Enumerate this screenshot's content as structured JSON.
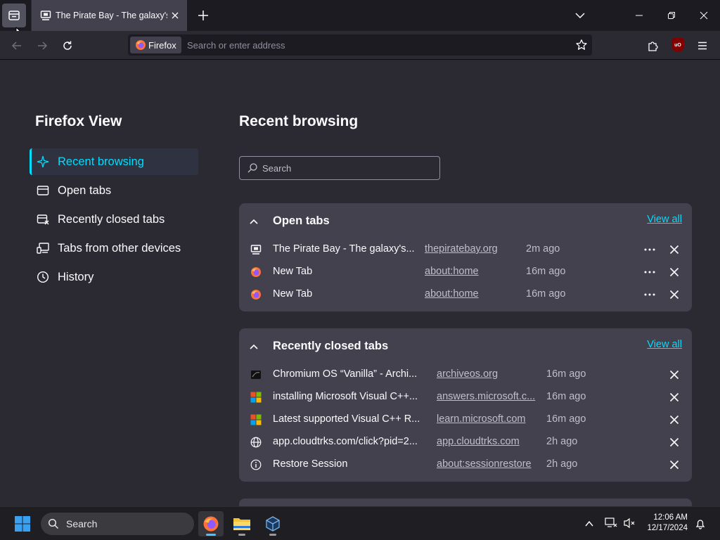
{
  "tab": {
    "title": "The Pirate Bay - The galaxy's m"
  },
  "urlbar": {
    "identity_label": "Firefox",
    "placeholder": "Search or enter address"
  },
  "extension": {
    "ublock_label": "uO"
  },
  "sidebar": {
    "title": "Firefox View",
    "items": [
      {
        "label": "Recent browsing",
        "icon": "sparkle-icon",
        "active": true
      },
      {
        "label": "Open tabs",
        "icon": "folder-tab-icon"
      },
      {
        "label": "Recently closed tabs",
        "icon": "closed-tab-icon"
      },
      {
        "label": "Tabs from other devices",
        "icon": "devices-icon"
      },
      {
        "label": "History",
        "icon": "clock-icon"
      }
    ]
  },
  "main": {
    "title": "Recent browsing",
    "search_placeholder": "Search",
    "open_tabs": {
      "heading": "Open tabs",
      "view_all": "View all",
      "rows": [
        {
          "title": "The Pirate Bay - The galaxy's...",
          "url": "thepiratebay.org",
          "time": "2m ago",
          "icon": "pirate-ship-icon"
        },
        {
          "title": "New Tab",
          "url": "about:home",
          "time": "16m ago",
          "icon": "firefox-icon"
        },
        {
          "title": "New Tab",
          "url": "about:home",
          "time": "16m ago",
          "icon": "firefox-icon"
        }
      ]
    },
    "closed_tabs": {
      "heading": "Recently closed tabs",
      "view_all": "View all",
      "rows": [
        {
          "title": "Chromium OS “Vanilla” - Archi...",
          "url": "archiveos.org",
          "time": "16m ago",
          "icon": "archiveos-icon"
        },
        {
          "title": "installing Microsoft Visual C++...",
          "url": "answers.microsoft.c...",
          "time": "16m ago",
          "icon": "microsoft-icon"
        },
        {
          "title": "Latest supported Visual C++ R...",
          "url": "learn.microsoft.com",
          "time": "16m ago",
          "icon": "microsoft-icon"
        },
        {
          "title": "app.cloudtrks.com/click?pid=2...",
          "url": "app.cloudtrks.com",
          "time": "2h ago",
          "icon": "globe-icon"
        },
        {
          "title": "Restore Session",
          "url": "about:sessionrestore",
          "time": "2h ago",
          "icon": "info-icon"
        }
      ]
    }
  },
  "taskbar": {
    "search_label": "Search",
    "clock_time": "12:06 AM",
    "clock_date": "12/17/2024"
  },
  "colors": {
    "accent": "#00ddff",
    "card": "#42414d",
    "page": "#2b2a33"
  }
}
